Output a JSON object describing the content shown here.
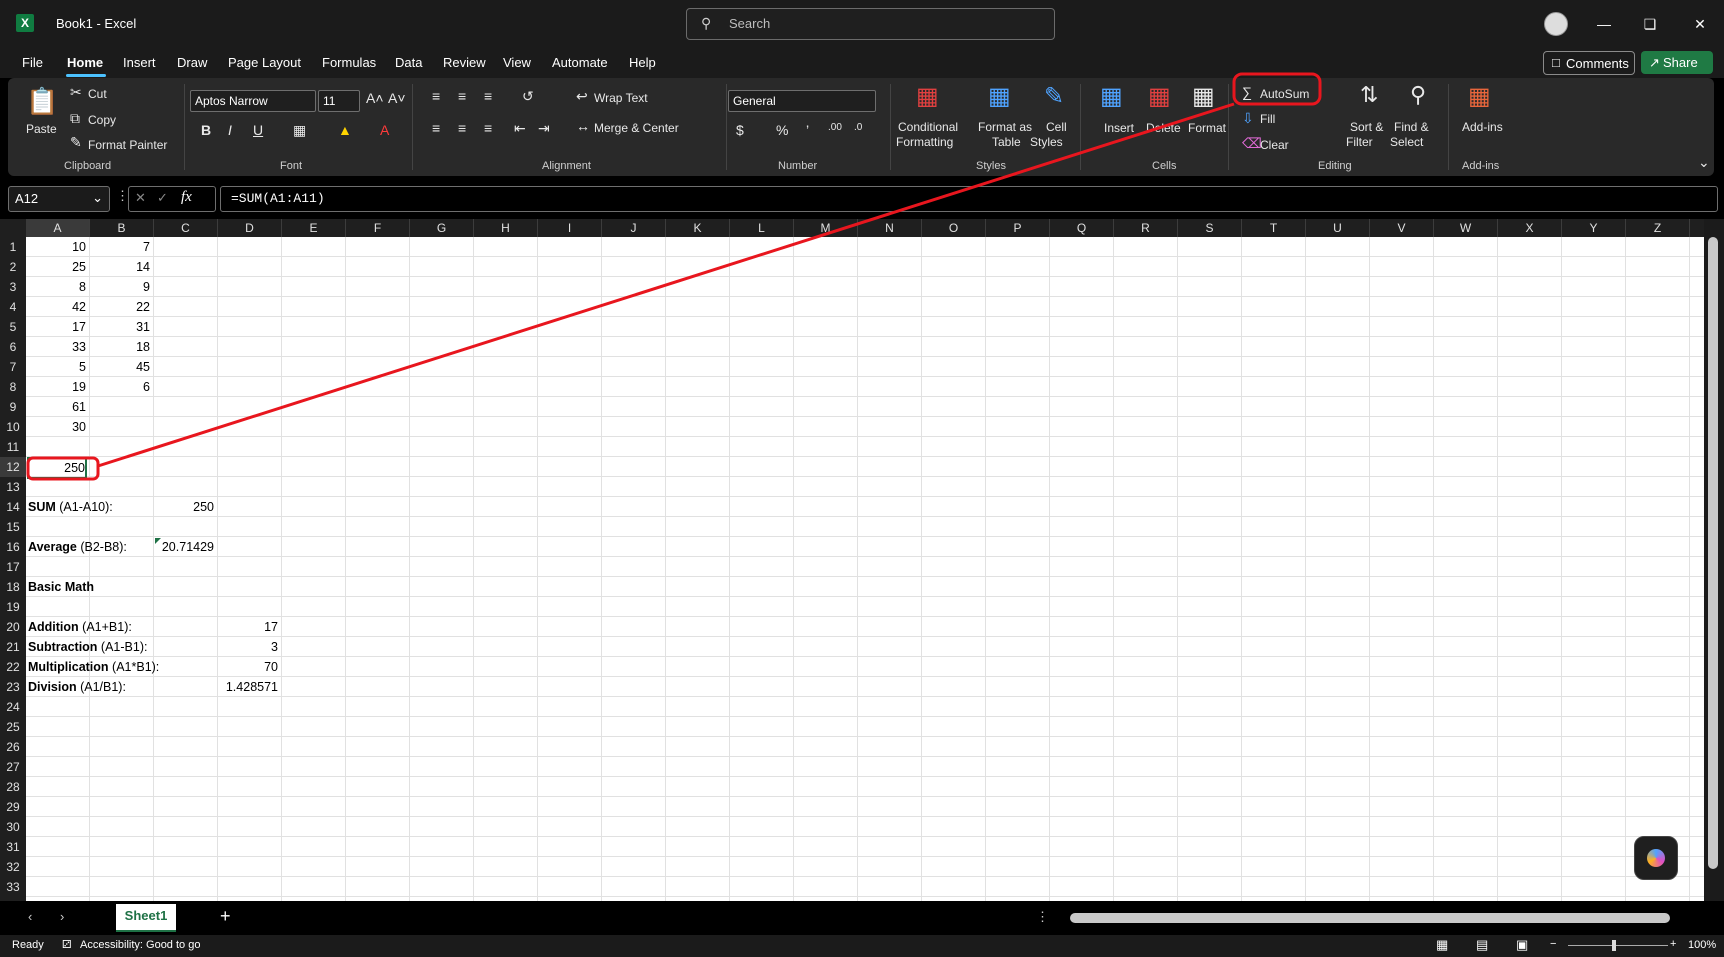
{
  "titlebar": {
    "doc_title": "Book1  -  Excel",
    "search_placeholder": "Search"
  },
  "menu": {
    "items": [
      "File",
      "Home",
      "Insert",
      "Draw",
      "Page Layout",
      "Formulas",
      "Data",
      "Review",
      "View",
      "Automate",
      "Help"
    ],
    "active": "Home",
    "comments": "Comments",
    "share": "Share"
  },
  "ribbon": {
    "clipboard": {
      "paste": "Paste",
      "cut": "Cut",
      "copy": "Copy",
      "format_painter": "Format Painter",
      "group": "Clipboard"
    },
    "font": {
      "name": "Aptos Narrow",
      "size": "11",
      "group": "Font"
    },
    "alignment": {
      "wrap": "Wrap Text",
      "merge": "Merge & Center",
      "group": "Alignment"
    },
    "number": {
      "format": "General",
      "group": "Number"
    },
    "styles": {
      "conditional": "Conditional",
      "conditional2": "Formatting",
      "format_as": "Format as",
      "format_as2": "Table",
      "cell": "Cell",
      "cell2": "Styles",
      "group": "Styles"
    },
    "cells": {
      "insert": "Insert",
      "delete": "Delete",
      "format": "Format",
      "group": "Cells"
    },
    "editing": {
      "autosum": "AutoSum",
      "fill": "Fill",
      "clear": "Clear",
      "sort": "Sort &",
      "sort2": "Filter",
      "find": "Find &",
      "find2": "Select",
      "group": "Editing"
    },
    "addins": {
      "label": "Add-ins",
      "group": "Add-ins"
    }
  },
  "formula_bar": {
    "namebox": "A12",
    "formula": "=SUM(A1:A11)"
  },
  "columns": [
    "A",
    "B",
    "C",
    "D",
    "E",
    "F",
    "G",
    "H",
    "I",
    "J",
    "K",
    "L",
    "M",
    "N",
    "O",
    "P",
    "Q",
    "R",
    "S",
    "T",
    "U",
    "V",
    "W",
    "X",
    "Y",
    "Z"
  ],
  "rows": [
    "1",
    "2",
    "3",
    "4",
    "5",
    "6",
    "7",
    "8",
    "9",
    "10",
    "11",
    "12",
    "13",
    "14",
    "15",
    "16",
    "17",
    "18",
    "19",
    "20",
    "21",
    "22",
    "23",
    "24",
    "25",
    "26",
    "27",
    "28",
    "29",
    "30",
    "31",
    "32",
    "33"
  ],
  "cells": {
    "colA": [
      "10",
      "25",
      "8",
      "42",
      "17",
      "33",
      "5",
      "19",
      "61",
      "30"
    ],
    "colB": [
      "7",
      "14",
      "9",
      "22",
      "31",
      "18",
      "45",
      "6"
    ],
    "a12": "250",
    "sum_label_bold": "SUM",
    "sum_label_rest": " (A1-A10):",
    "sum_value": "250",
    "avg_label_bold": "Average",
    "avg_label_rest": " (B2-B8):",
    "avg_value": "20.71429",
    "basic_math": "Basic Math",
    "add_bold": "Addition",
    "add_rest": " (A1+B1):",
    "add_value": "17",
    "sub_bold": "Subtraction",
    "sub_rest": " (A1-B1):",
    "sub_value": "3",
    "mul_bold": "Multiplication",
    "mul_rest": " (A1*B1):",
    "mul_value": "70",
    "div_bold": "Division",
    "div_rest": " (A1/B1):",
    "div_value": "1.428571"
  },
  "sheet_tab": "Sheet1",
  "status": {
    "ready": "Ready",
    "accessibility": "Accessibility: Good to go",
    "zoom": "100%"
  },
  "colors": {
    "accent": "#107c41",
    "annotation": "#e8161e"
  }
}
